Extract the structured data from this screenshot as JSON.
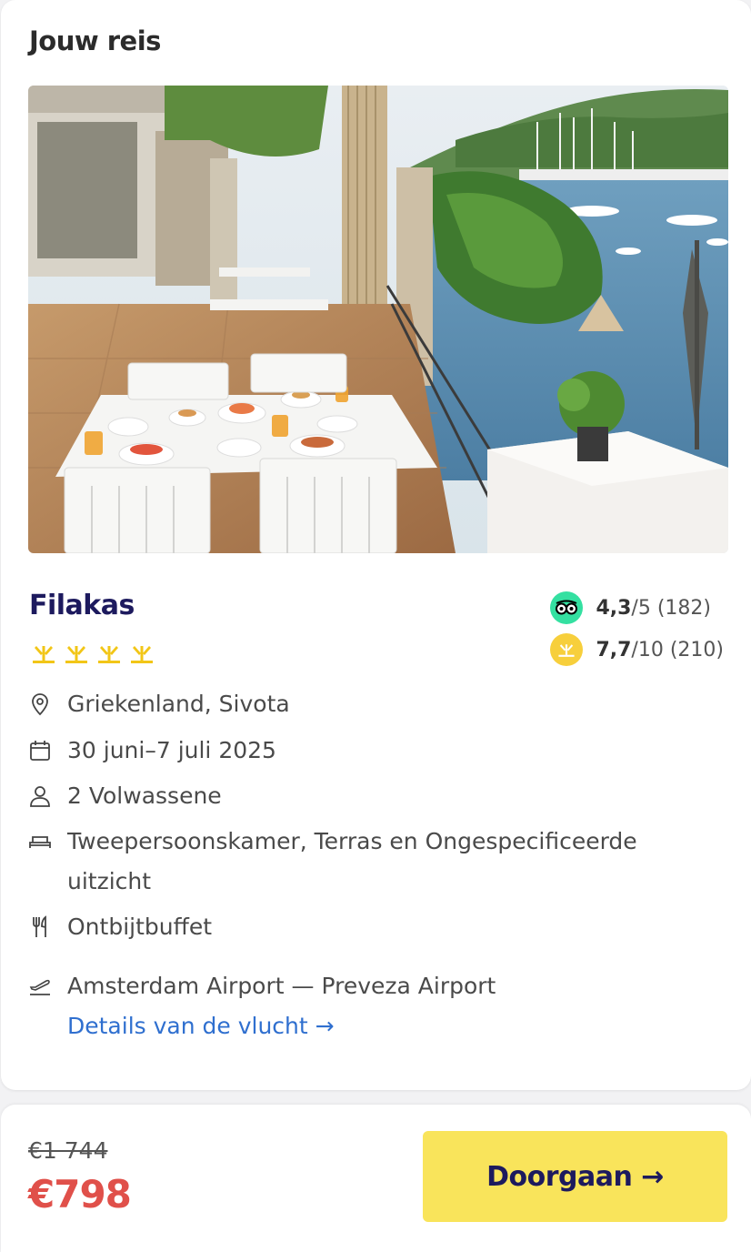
{
  "card": {
    "title": "Jouw reis"
  },
  "hotel": {
    "name": "Filakas",
    "star_count": 4,
    "star_color": "#f2c617",
    "ratings": [
      {
        "source_icon": "tripadvisor-icon",
        "score": "4,3",
        "scale": "/5",
        "count": "(182)",
        "badge_color": "#34e0a1"
      },
      {
        "source_icon": "sunweb-sun-icon",
        "score": "7,7",
        "scale": "/10",
        "count": "(210)",
        "badge_color": "#f7cf3c"
      }
    ]
  },
  "details": {
    "location": "Griekenland, Sivota",
    "dates": "30 juni–7 juli 2025",
    "guests": "2 Volwassene",
    "room": "Tweepersoonskamer, Terras en Ongespecificeerde uitzicht",
    "meal": "Ontbijtbuffet",
    "flight": "Amsterdam Airport — Preveza Airport",
    "flight_link": "Details van de vlucht →"
  },
  "price": {
    "old": "€1 744",
    "new": "€798"
  },
  "cta": {
    "label": "Doorgaan →"
  },
  "colors": {
    "accent_yellow": "#f9e45b",
    "brand_navy": "#1d1a5e",
    "price_red": "#e0504a",
    "link_blue": "#2f6fcf"
  }
}
